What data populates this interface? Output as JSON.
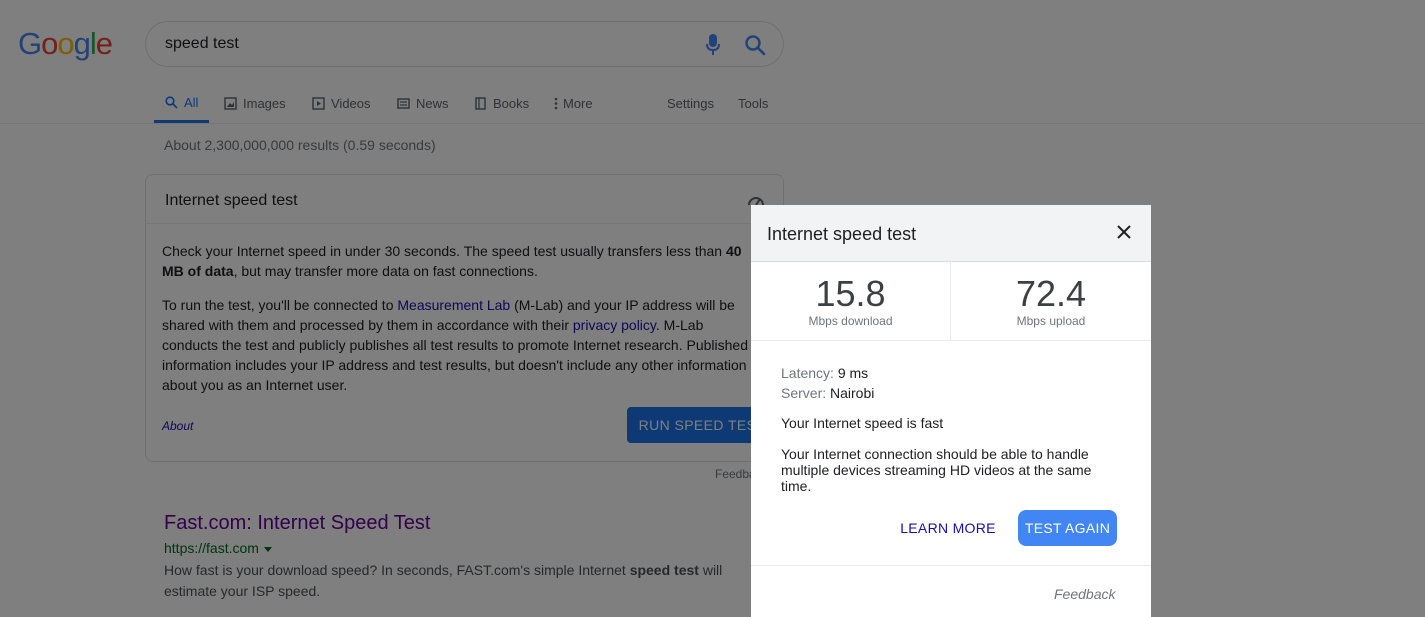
{
  "logo": {
    "letters": [
      "G",
      "o",
      "o",
      "g",
      "l",
      "e"
    ],
    "colors": [
      "#4285f4",
      "#ea4335",
      "#fbbc05",
      "#4285f4",
      "#34a853",
      "#ea4335"
    ]
  },
  "search": {
    "query": "speed test"
  },
  "tabs": [
    {
      "label": "All",
      "icon": "search-icon",
      "active": true
    },
    {
      "label": "Images",
      "icon": "image-icon"
    },
    {
      "label": "Videos",
      "icon": "video-icon"
    },
    {
      "label": "News",
      "icon": "news-icon"
    },
    {
      "label": "Books",
      "icon": "book-icon"
    },
    {
      "label": "More",
      "icon": "more-vert-icon"
    }
  ],
  "tools": {
    "settings": "Settings",
    "tools": "Tools"
  },
  "result_stats": "About 2,300,000,000 results (0.59 seconds)",
  "card": {
    "title": "Internet speed test",
    "p1_start": "Check your Internet speed in under 30 seconds. The speed test usually transfers less than ",
    "p1_bold": "40 MB of data",
    "p1_end": ", but may transfer more data on fast connections.",
    "p2_a": "To run the test, you'll be connected to ",
    "p2_link1": "Measurement Lab",
    "p2_b": " (M-Lab) and your IP address will be shared with them and processed by them in accordance with their ",
    "p2_link2": "privacy policy",
    "p2_c": ". M-Lab conducts the test and publicly publishes all test results to promote Internet research. Published information includes your IP address and test results, but doesn't include any other information about you as an Internet user.",
    "about": "About",
    "run_button": "RUN SPEED TEST",
    "feedback": "Feedback"
  },
  "result": {
    "title": "Fast.com: Internet Speed Test",
    "url": "https://fast.com",
    "snippet_a": "How fast is your download speed? In seconds, FAST.com's simple Internet ",
    "snippet_bold": "speed test",
    "snippet_b": " will estimate your ISP speed."
  },
  "dialog": {
    "title": "Internet speed test",
    "download_value": "15.8",
    "download_unit": "Mbps download",
    "upload_value": "72.4",
    "upload_unit": "Mbps upload",
    "latency_label": "Latency:",
    "latency_value": "9 ms",
    "server_label": "Server:",
    "server_value": "Nairobi",
    "verdict": "Your Internet speed is fast",
    "description": "Your Internet connection should be able to handle multiple devices streaming HD videos at the same time.",
    "learn_more": "LEARN MORE",
    "test_again": "TEST AGAIN",
    "feedback": "Feedback"
  }
}
